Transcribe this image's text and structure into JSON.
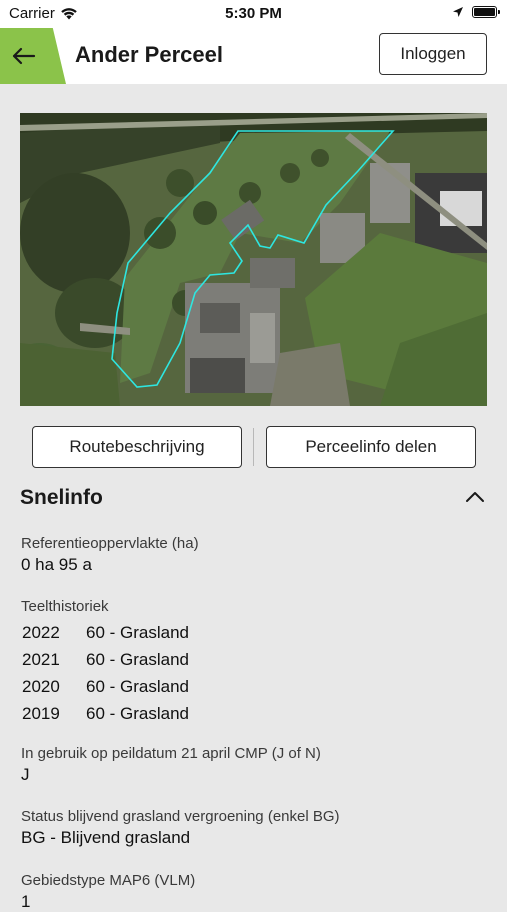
{
  "status_bar": {
    "carrier": "Carrier",
    "time": "5:30 PM"
  },
  "nav": {
    "title": "Ander Perceel",
    "login_label": "Inloggen",
    "accent_color": "#8bc34a"
  },
  "actions": {
    "route_label": "Routebeschrijving",
    "share_label": "Perceelinfo delen"
  },
  "snelinfo": {
    "title": "Snelinfo",
    "fields": [
      {
        "label": "Referentieoppervlakte (ha)",
        "value": "0 ha 95 a"
      },
      {
        "label": "Teelthistoriek"
      },
      {
        "label": "In gebruik op peildatum 21 april CMP (J of N)",
        "value": "J"
      },
      {
        "label": "Status blijvend grasland vergroening (enkel BG)",
        "value": "BG - Blijvend grasland"
      },
      {
        "label": "Gebiedstype MAP6 (VLM)",
        "value": "1"
      }
    ],
    "history": [
      {
        "year": "2022",
        "crop": "60 - Grasland"
      },
      {
        "year": "2021",
        "crop": "60 - Grasland"
      },
      {
        "year": "2020",
        "crop": "60 - Grasland"
      },
      {
        "year": "2019",
        "crop": "60 - Grasland"
      }
    ]
  },
  "map": {
    "parcel_outline_color": "#2ee6e0"
  }
}
